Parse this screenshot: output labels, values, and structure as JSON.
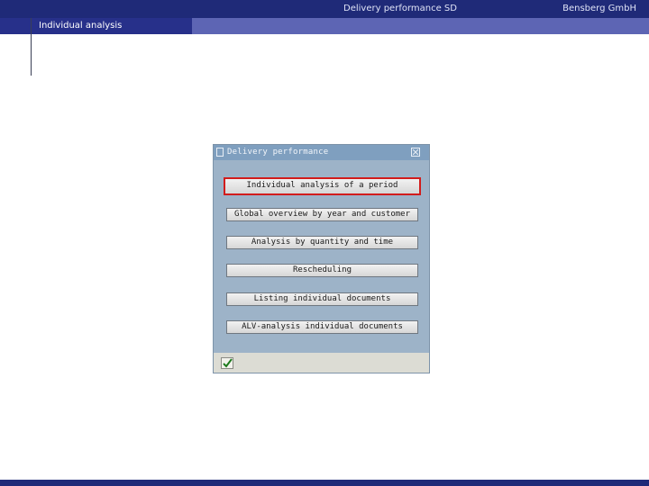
{
  "header": {
    "title": "Delivery performance SD",
    "company": "Bensberg GmbH",
    "section": "Individual analysis"
  },
  "dialog": {
    "title": "Delivery performance",
    "buttons": [
      "Individual analysis of a period",
      "Global overview by year and customer",
      "Analysis by quantity and time",
      "Rescheduling",
      "Listing individual documents",
      "ALV-analysis individual documents"
    ],
    "selected_button": 0,
    "icons": {
      "title": "document-icon",
      "close": "close-icon",
      "ok": "checkmark-icon"
    }
  },
  "colors": {
    "header_bar": "#1f2a78",
    "subheader_bar": "#5d65b4",
    "dialog_bg": "#9db3c8",
    "selection_border": "#d21c1c"
  }
}
